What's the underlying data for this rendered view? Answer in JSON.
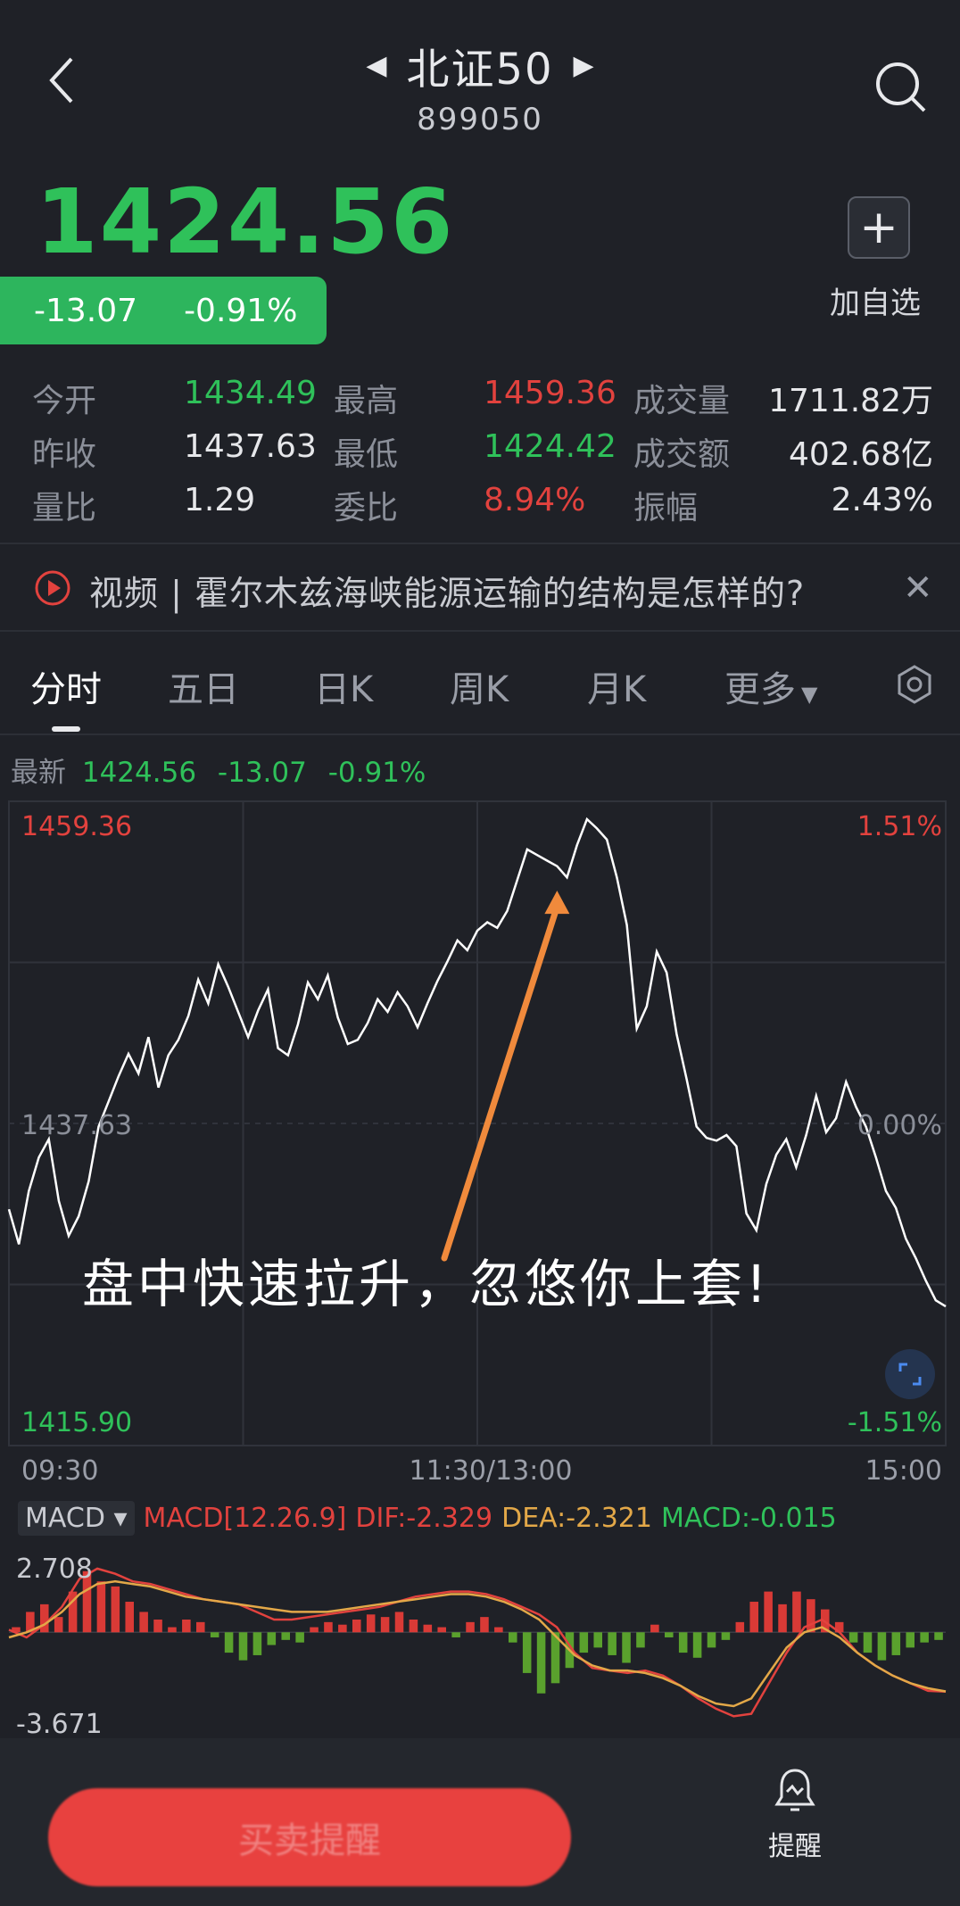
{
  "header": {
    "title": "北证50",
    "code": "899050"
  },
  "quote": {
    "price": "1424.56",
    "change": "-13.07",
    "change_pct": "-0.91%",
    "add_label": "加自选"
  },
  "stats": {
    "open_label": "今开",
    "open": "1434.49",
    "high_label": "最高",
    "high": "1459.36",
    "volume_label": "成交量",
    "volume": "1711.82万",
    "prev_close_label": "昨收",
    "prev_close": "1437.63",
    "low_label": "最低",
    "low": "1424.42",
    "amount_label": "成交额",
    "amount": "402.68亿",
    "vol_ratio_label": "量比",
    "vol_ratio": "1.29",
    "order_ratio_label": "委比",
    "order_ratio": "8.94%",
    "amplitude_label": "振幅",
    "amplitude": "2.43%"
  },
  "news": {
    "text": "视频 | 霍尔木兹海峡能源运输的结构是怎样的?"
  },
  "tabs": [
    "分时",
    "五日",
    "日K",
    "周K",
    "月K",
    "更多"
  ],
  "chart_info": {
    "latest_label": "最新",
    "latest_price": "1424.56",
    "latest_change": "-13.07",
    "latest_pct": "-0.91%",
    "overlay_text": "盘中快速拉升，忽悠你上套!"
  },
  "colors": {
    "up": "#e2423e",
    "down": "#2fc15a",
    "price_line": "#ffffff",
    "annotation_arrow": "#f08a3c"
  },
  "chart_data": [
    {
      "type": "line",
      "ylim": [
        1415.9,
        1459.36
      ],
      "y_ticks_left": [
        "1459.36",
        "1437.63",
        "1415.90"
      ],
      "y_ticks_right": [
        "1.51%",
        "0.00%",
        "-1.51%"
      ],
      "x_ticks": [
        "09:30",
        "11:30/13:00",
        "15:00"
      ],
      "series": [
        {
          "values": [
            1431.5,
            1429.0,
            1432.8,
            1435.2,
            1436.5,
            1432.1,
            1429.6,
            1431.0,
            1433.5,
            1437.4,
            1439.2,
            1441.0,
            1442.6,
            1441.2,
            1443.8,
            1440.2,
            1442.5,
            1443.6,
            1445.3,
            1447.9,
            1446.2,
            1449.0,
            1447.4,
            1445.6,
            1443.8,
            1445.7,
            1447.2,
            1443.0,
            1442.5,
            1444.7,
            1447.7,
            1446.5,
            1448.2,
            1445.2,
            1443.3,
            1443.6,
            1444.8,
            1446.5,
            1445.6,
            1447.0,
            1446.0,
            1444.5,
            1446.2,
            1447.8,
            1449.2,
            1450.7,
            1450.0,
            1451.4,
            1452.0,
            1451.6,
            1452.8,
            1455.0,
            1457.2,
            1456.8,
            1456.4,
            1456.0,
            1455.2,
            1457.5,
            1459.36,
            1458.7,
            1457.9,
            1455.2,
            1451.8,
            1444.4,
            1446.0,
            1449.9,
            1448.4,
            1444.0,
            1440.8,
            1437.4,
            1436.6,
            1436.4,
            1436.8,
            1436.0,
            1431.2,
            1430.0,
            1433.3,
            1435.4,
            1436.5,
            1434.5,
            1436.8,
            1439.6,
            1437.0,
            1438.0,
            1440.6,
            1438.8,
            1437.4,
            1435.2,
            1432.8,
            1431.6,
            1429.4,
            1428.0,
            1426.4,
            1425.0,
            1424.56
          ],
          "color": "#ffffff"
        }
      ]
    },
    {
      "type": "bar",
      "indicator_select": "MACD",
      "params_label": "MACD[12.26.9]",
      "dif_label": "DIF:-2.329",
      "dea_label": "DEA:-2.321",
      "macd_label": "MACD:-0.015",
      "ylim": [
        -3.671,
        2.708
      ],
      "y_ticks": [
        "2.708",
        "-3.671"
      ],
      "series": [
        {
          "name": "MACD",
          "values": [
            0.2,
            0.8,
            1.1,
            0.6,
            1.6,
            2.4,
            2.0,
            1.8,
            1.2,
            0.8,
            0.5,
            0.2,
            0.5,
            0.4,
            -0.2,
            -0.8,
            -1.1,
            -0.9,
            -0.5,
            -0.3,
            -0.4,
            0.2,
            0.4,
            0.3,
            0.5,
            0.7,
            0.6,
            0.8,
            0.5,
            0.3,
            0.2,
            -0.2,
            0.4,
            0.6,
            0.2,
            -0.4,
            -1.6,
            -2.4,
            -2.0,
            -1.4,
            -0.8,
            -0.6,
            -0.9,
            -1.2,
            -0.6,
            0.3,
            -0.2,
            -0.8,
            -1.0,
            -0.6,
            -0.3,
            0.4,
            1.2,
            1.6,
            1.1,
            1.6,
            1.3,
            0.9,
            0.4,
            -0.4,
            -0.8,
            -1.1,
            -0.9,
            -0.6,
            -0.4,
            -0.3
          ]
        },
        {
          "name": "DIF",
          "values": [
            0.1,
            -0.2,
            0.3,
            1.0,
            2.1,
            2.5,
            2.3,
            2.0,
            1.9,
            1.7,
            1.5,
            1.3,
            1.2,
            1.1,
            0.8,
            0.5,
            0.5,
            0.6,
            0.7,
            0.8,
            0.9,
            1.0,
            1.2,
            1.4,
            1.5,
            1.6,
            1.6,
            1.5,
            1.3,
            1.0,
            0.7,
            0.2,
            -0.8,
            -1.4,
            -1.5,
            -1.6,
            -1.5,
            -1.7,
            -2.1,
            -2.6,
            -3.0,
            -3.3,
            -3.2,
            -2.0,
            -0.8,
            0.2,
            0.5,
            0.0,
            -0.8,
            -1.3,
            -1.7,
            -2.0,
            -2.3,
            -2.33
          ]
        },
        {
          "name": "DEA",
          "values": [
            -0.2,
            0.0,
            0.3,
            0.8,
            1.5,
            1.9,
            2.0,
            1.9,
            1.8,
            1.6,
            1.4,
            1.3,
            1.2,
            1.1,
            1.0,
            0.9,
            0.8,
            0.8,
            0.8,
            0.9,
            1.0,
            1.1,
            1.2,
            1.3,
            1.4,
            1.5,
            1.5,
            1.4,
            1.2,
            0.9,
            0.5,
            -0.2,
            -0.9,
            -1.3,
            -1.5,
            -1.5,
            -1.6,
            -1.8,
            -2.1,
            -2.5,
            -2.8,
            -2.9,
            -2.6,
            -1.6,
            -0.6,
            0.0,
            0.2,
            -0.2,
            -0.8,
            -1.3,
            -1.7,
            -2.0,
            -2.2,
            -2.32
          ]
        }
      ]
    }
  ],
  "bottom": {
    "trade_label": "买卖提醒",
    "alert_label": "提醒"
  }
}
